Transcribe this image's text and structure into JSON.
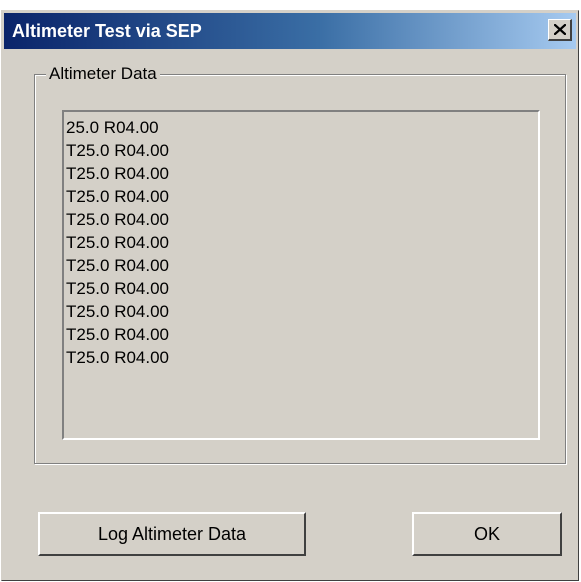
{
  "window": {
    "title": "Altimeter Test via SEP"
  },
  "group": {
    "label": "Altimeter Data"
  },
  "altimeter_data": {
    "lines": [
      "25.0 R04.00",
      "T25.0 R04.00",
      "T25.0 R04.00",
      "T25.0 R04.00",
      "T25.0 R04.00",
      "T25.0 R04.00",
      "T25.0 R04.00",
      "T25.0 R04.00",
      "T25.0 R04.00",
      "T25.0 R04.00",
      "T25.0 R04.00"
    ]
  },
  "buttons": {
    "log_label": "Log Altimeter Data",
    "ok_label": "OK"
  },
  "icons": {
    "close": "close-icon"
  },
  "colors": {
    "titlebar_start": "#0a246a",
    "titlebar_end": "#a6caf0",
    "dialog_face": "#d4d0c8"
  }
}
